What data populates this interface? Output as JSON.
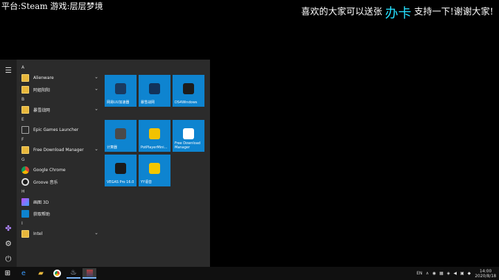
{
  "overlay": {
    "left_text": "平台:Steam 游戏:层层梦境",
    "right_before": "喜欢的大家可以送张",
    "right_highlight": "办卡",
    "right_after": "支持一下!谢谢大家!"
  },
  "start_menu": {
    "apps": [
      {
        "type": "letter",
        "text": "A"
      },
      {
        "type": "app",
        "label": "Alienware",
        "icon": "folder-icon",
        "chevron": true
      },
      {
        "type": "app",
        "label": "阿姐阳阳",
        "icon": "folder-icon",
        "chevron": true
      },
      {
        "type": "letter",
        "text": "B"
      },
      {
        "type": "app",
        "label": "暴雪战网",
        "icon": "folder-icon",
        "chevron": true
      },
      {
        "type": "letter",
        "text": "E"
      },
      {
        "type": "app",
        "label": "Epic Games Launcher",
        "icon": "epic-icon",
        "chevron": false
      },
      {
        "type": "letter",
        "text": "F"
      },
      {
        "type": "app",
        "label": "Free Download Manager",
        "icon": "folder-icon",
        "chevron": true
      },
      {
        "type": "letter",
        "text": "G"
      },
      {
        "type": "app",
        "label": "Google Chrome",
        "icon": "chrome-icon",
        "chevron": false
      },
      {
        "type": "app",
        "label": "Groove 音乐",
        "icon": "groove-icon",
        "chevron": false
      },
      {
        "type": "letter",
        "text": "H"
      },
      {
        "type": "app",
        "label": "画图 3D",
        "icon": "paint3d-icon",
        "chevron": false
      },
      {
        "type": "app",
        "label": "获取帮助",
        "icon": "help-icon",
        "chevron": false
      },
      {
        "type": "letter",
        "text": "I"
      },
      {
        "type": "app",
        "label": "Intel",
        "icon": "folder-icon",
        "chevron": true
      }
    ],
    "tiles": [
      {
        "label": "网易UU加速器",
        "icon": "uu-icon",
        "color": "#1a3a60"
      },
      {
        "label": "暴雪战网",
        "icon": "battlenet-icon",
        "color": "#12325a"
      },
      {
        "label": "DS4Windows",
        "icon": "gamepad-icon",
        "color": "#1c1c1c"
      },
      {
        "label": "计算器",
        "icon": "calculator-icon",
        "color": "#4a4a4a"
      },
      {
        "label": "PotPlayerMini...",
        "icon": "potplayer-icon",
        "color": "#f2c200"
      },
      {
        "label": "Free Download Manager",
        "icon": "fdm-icon",
        "color": "#ffffff"
      },
      {
        "label": "VEGAS Pro 16.0",
        "icon": "vegas-icon",
        "color": "#1a1a1a"
      },
      {
        "label": "YY语音",
        "icon": "yy-icon",
        "color": "#f3c600"
      }
    ]
  },
  "taskbar": {
    "tray_lang": "EN",
    "time": "14:00",
    "date": "2020/8/18"
  }
}
